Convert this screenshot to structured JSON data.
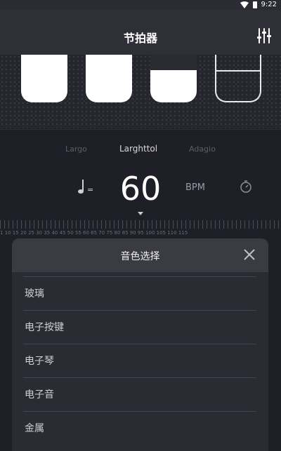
{
  "status": {
    "time": "9:22"
  },
  "header": {
    "title": "节拍器"
  },
  "beat_pads": [
    {
      "state": "full"
    },
    {
      "state": "full"
    },
    {
      "state": "partial"
    },
    {
      "state": "hollow"
    }
  ],
  "tempo": {
    "names": [
      "Largo",
      "Larghttol",
      "Adagio"
    ],
    "active_name": "Larghttol",
    "bpm": "60",
    "unit": "BPM",
    "note_equals": "=",
    "ruler_numbers": "1 10 15 20 25 30 35 40 45 50 55 60 65 70 75 80 85 90 95 100 105 110 115"
  },
  "sound_sheet": {
    "title": "音色选择",
    "options": [
      "玻璃",
      "电子按键",
      "电子琴",
      "电子音",
      "金属"
    ]
  },
  "colors": {
    "background": "#1f2027",
    "sheet": "#2a2b33",
    "sheet_header": "#3a3b43",
    "accent_text": "#ffffff"
  },
  "icons": {
    "settings": "sliders-icon",
    "close": "close-icon",
    "note": "quarter-note-icon",
    "timer": "timer-icon"
  }
}
